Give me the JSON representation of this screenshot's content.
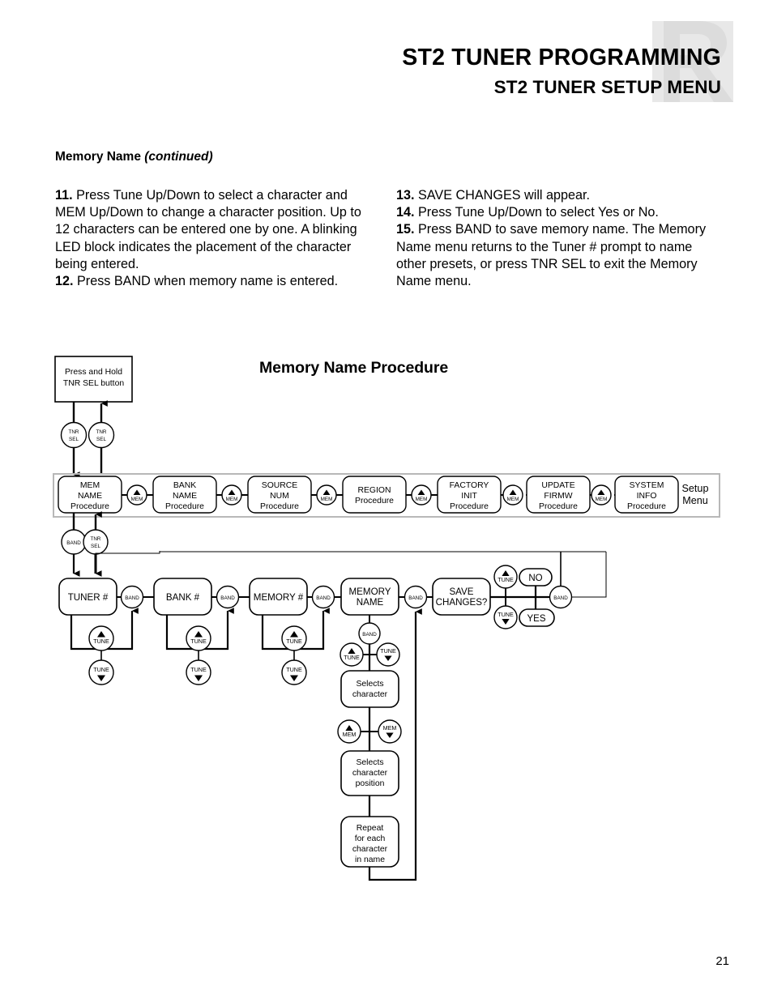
{
  "header": {
    "title_main": "ST2 TUNER PROGRAMMING",
    "title_sub": "ST2 TUNER SETUP MENU",
    "watermark": "R"
  },
  "section": {
    "heading_main": "Memory Name ",
    "heading_italic": "(continued)"
  },
  "body": {
    "left": [
      {
        "num": "11.",
        "text": " Press Tune Up/Down to select a character and MEM Up/Down to change a character position. Up to 12 characters can be entered one by one. A blinking LED block indicates the placement of the character being entered."
      },
      {
        "num": "12.",
        "text": " Press BAND when memory name is entered."
      }
    ],
    "right": [
      {
        "num": "13.",
        "text": " SAVE CHANGES will appear."
      },
      {
        "num": "14.",
        "text": " Press Tune Up/Down to select Yes or No."
      },
      {
        "num": "15.",
        "text": " Press BAND to save memory name. The Memory Name menu returns to the Tuner # prompt to name other presets, or press TNR SEL to exit the Memory Name menu."
      }
    ]
  },
  "page_number": "21",
  "diagram": {
    "title": "Memory Name Procedure",
    "start_box": {
      "line1": "Press and Hold",
      "line2": "TNR SEL button"
    },
    "start_buttons": [
      {
        "line1": "TNR",
        "line2": "SEL"
      },
      {
        "line1": "TNR",
        "line2": "SEL"
      }
    ],
    "setup_menu_label": {
      "line1": "Setup",
      "line2": "Menu"
    },
    "setup_menu_items": [
      {
        "line1": "MEM",
        "line2": "NAME",
        "line3": "Procedure"
      },
      {
        "line1": "BANK",
        "line2": "NAME",
        "line3": "Procedure"
      },
      {
        "line1": "SOURCE",
        "line2": "NUM",
        "line3": "Procedure"
      },
      {
        "line1": "REGION",
        "line2": "",
        "line3": "Procedure"
      },
      {
        "line1": "FACTORY",
        "line2": "INIT",
        "line3": "Procedure"
      },
      {
        "line1": "UPDATE",
        "line2": "FIRMW",
        "line3": "Procedure"
      },
      {
        "line1": "SYSTEM",
        "line2": "INFO",
        "line3": "Procedure"
      }
    ],
    "setup_menu_connectors": [
      "MEM",
      "MEM",
      "MEM",
      "MEM",
      "MEM",
      "MEM"
    ],
    "exit_buttons": [
      {
        "line1": "BAND",
        "line2": ""
      },
      {
        "line1": "TNR",
        "line2": "SEL"
      }
    ],
    "flow_nodes": [
      {
        "line1": "TUNER #",
        "line2": ""
      },
      {
        "line1": "BANK #",
        "line2": ""
      },
      {
        "line1": "MEMORY #",
        "line2": ""
      },
      {
        "line1": "MEMORY",
        "line2": "NAME"
      },
      {
        "line1": "SAVE",
        "line2": "CHANGES?"
      }
    ],
    "flow_connectors": [
      "BAND",
      "BAND",
      "BAND",
      "BAND"
    ],
    "tune_loops": [
      {
        "up": "TUNE",
        "down": "TUNE"
      },
      {
        "up": "TUNE",
        "down": "TUNE"
      },
      {
        "up": "TUNE",
        "down": "TUNE"
      }
    ],
    "save_tune_up": "TUNE",
    "save_tune_down": "TUNE",
    "answer_no": "NO",
    "answer_yes": "YES",
    "answer_band": "BAND",
    "memname_band": "BAND",
    "char_tune_up": "TUNE",
    "char_tune_down": "TUNE",
    "selects_character": {
      "line1": "Selects",
      "line2": "character"
    },
    "pos_mem_up": "MEM",
    "pos_mem_down": "MEM",
    "selects_character_position": {
      "line1": "Selects",
      "line2": "character",
      "line3": "position"
    },
    "repeat_box": {
      "line1": "Repeat",
      "line2": "for each",
      "line3": "character",
      "line4": "in name"
    }
  }
}
